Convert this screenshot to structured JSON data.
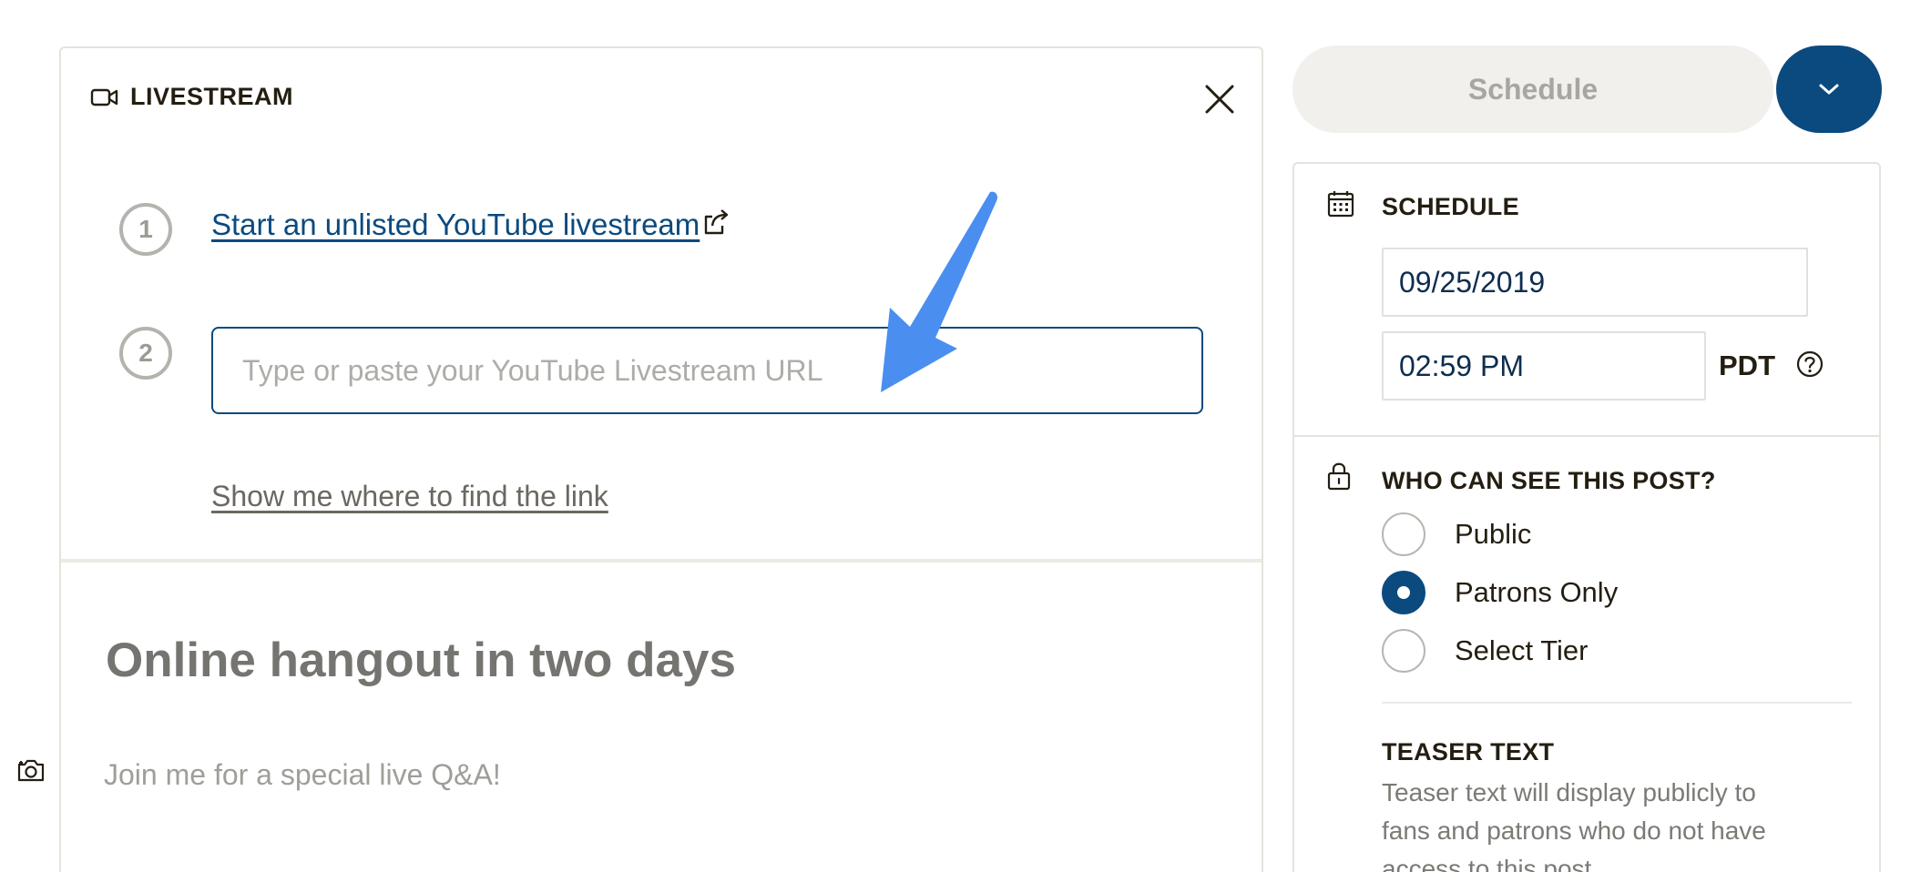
{
  "livestream": {
    "title": "LIVESTREAM",
    "step1_number": "1",
    "step2_number": "2",
    "youtube_link": "Start an unlisted YouTube livestream",
    "url_placeholder": "Type or paste your YouTube Livestream URL",
    "find_link": "Show me where to find the link"
  },
  "post": {
    "title": "Online hangout in two days",
    "body": "Join me for a special live Q&A!"
  },
  "actions": {
    "schedule_label": "Schedule"
  },
  "schedule": {
    "label": "SCHEDULE",
    "date": "09/25/2019",
    "time": "02:59 PM",
    "timezone": "PDT"
  },
  "visibility": {
    "label": "WHO CAN SEE THIS POST?",
    "options": [
      {
        "label": "Public",
        "selected": false
      },
      {
        "label": "Patrons Only",
        "selected": true
      },
      {
        "label": "Select Tier",
        "selected": false
      }
    ]
  },
  "teaser": {
    "label": "TEASER TEXT",
    "description": "Teaser text will display publicly to fans and patrons who do not have access to this post."
  },
  "colors": {
    "accent": "#0b4a7f",
    "arrow": "#4a8ef0"
  },
  "icons": [
    "video-camera-icon",
    "close-icon",
    "external-link-icon",
    "camera-icon",
    "chevron-down-icon",
    "calendar-icon",
    "lock-icon",
    "help-icon"
  ]
}
